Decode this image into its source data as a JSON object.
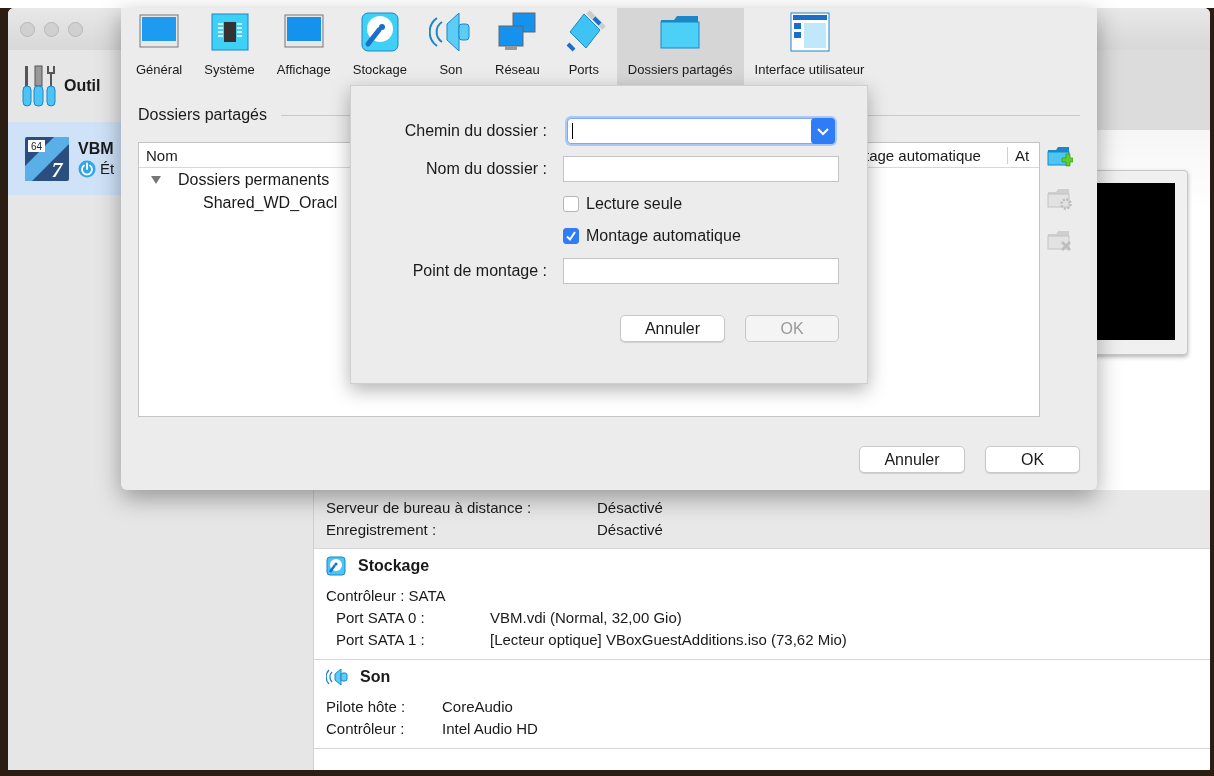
{
  "main_window": {
    "sidebar": {
      "tools_label": "Outil",
      "vm": {
        "name": "VBM",
        "status": "Ét",
        "badge": "64",
        "version": "7",
        "selected": true
      }
    },
    "details": {
      "display_rows": [
        {
          "label": "Serveur de bureau à distance :",
          "value": "Désactivé"
        },
        {
          "label": "Enregistrement :",
          "value": "Désactivé"
        }
      ],
      "sections": [
        {
          "title": "Stockage",
          "rows": [
            {
              "label": "Contrôleur : SATA",
              "children": [
                {
                  "label": "Port SATA 0 :",
                  "value": "VBM.vdi (Normal, 32,00 Gio)"
                },
                {
                  "label": "Port SATA 1 :",
                  "value": "[Lecteur optique] VBoxGuestAdditions.iso (73,62 Mio)"
                }
              ]
            }
          ]
        },
        {
          "title": "Son",
          "rows": [
            {
              "label": "Pilote hôte :",
              "value": "CoreAudio"
            },
            {
              "label": "Contrôleur :",
              "value": "Intel Audio HD"
            }
          ]
        }
      ]
    }
  },
  "settings_dialog": {
    "tabs": [
      {
        "label": "Général",
        "selected": false
      },
      {
        "label": "Système",
        "selected": false
      },
      {
        "label": "Affichage",
        "selected": false
      },
      {
        "label": "Stockage",
        "selected": false
      },
      {
        "label": "Son",
        "selected": false
      },
      {
        "label": "Réseau",
        "selected": false
      },
      {
        "label": "Ports",
        "selected": false
      },
      {
        "label": "Dossiers partagés",
        "selected": true
      },
      {
        "label": "Interface utilisateur",
        "selected": false
      }
    ],
    "group_title": "Dossiers partagés",
    "table": {
      "columns": [
        "Nom",
        "tage automatique",
        "At"
      ],
      "rows": [
        {
          "name": "Dossiers permanents",
          "expanded": true,
          "children": [
            {
              "name": "Shared_WD_Oracl"
            }
          ]
        }
      ]
    },
    "side_buttons": [
      {
        "kind": "add",
        "disabled": false
      },
      {
        "kind": "edit",
        "disabled": true
      },
      {
        "kind": "remove",
        "disabled": true
      }
    ],
    "buttons": [
      {
        "label": "Annuler",
        "disabled": false
      },
      {
        "label": "OK",
        "disabled": false
      }
    ]
  },
  "folder_sheet": {
    "rows": [
      {
        "kind": "combo",
        "label": "Chemin du dossier :"
      },
      {
        "kind": "text",
        "label": "Nom du dossier :"
      },
      {
        "kind": "checkbox",
        "label": "Lecture seule",
        "checked": false
      },
      {
        "kind": "checkbox",
        "label": "Montage automatique",
        "checked": true
      },
      {
        "kind": "text",
        "label": "Point de montage :"
      }
    ],
    "buttons": [
      {
        "label": "Annuler",
        "disabled": false
      },
      {
        "label": "OK",
        "disabled": true
      }
    ]
  }
}
